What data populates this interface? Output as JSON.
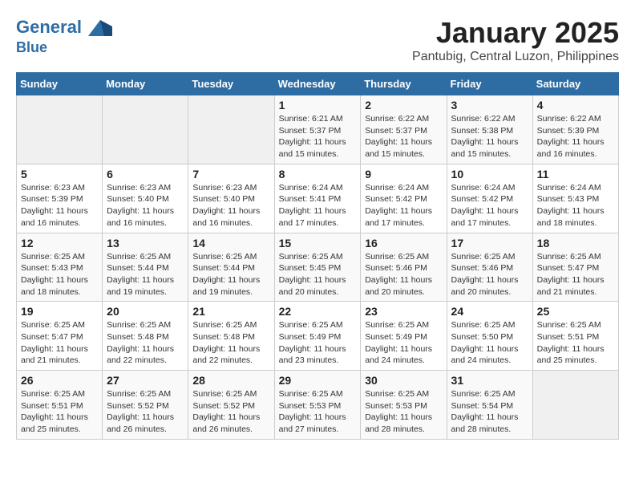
{
  "header": {
    "logo_line1": "General",
    "logo_line2": "Blue",
    "title": "January 2025",
    "subtitle": "Pantubig, Central Luzon, Philippines"
  },
  "weekdays": [
    "Sunday",
    "Monday",
    "Tuesday",
    "Wednesday",
    "Thursday",
    "Friday",
    "Saturday"
  ],
  "weeks": [
    [
      {
        "day": "",
        "info": ""
      },
      {
        "day": "",
        "info": ""
      },
      {
        "day": "",
        "info": ""
      },
      {
        "day": "1",
        "info": "Sunrise: 6:21 AM\nSunset: 5:37 PM\nDaylight: 11 hours and 15 minutes."
      },
      {
        "day": "2",
        "info": "Sunrise: 6:22 AM\nSunset: 5:37 PM\nDaylight: 11 hours and 15 minutes."
      },
      {
        "day": "3",
        "info": "Sunrise: 6:22 AM\nSunset: 5:38 PM\nDaylight: 11 hours and 15 minutes."
      },
      {
        "day": "4",
        "info": "Sunrise: 6:22 AM\nSunset: 5:39 PM\nDaylight: 11 hours and 16 minutes."
      }
    ],
    [
      {
        "day": "5",
        "info": "Sunrise: 6:23 AM\nSunset: 5:39 PM\nDaylight: 11 hours and 16 minutes."
      },
      {
        "day": "6",
        "info": "Sunrise: 6:23 AM\nSunset: 5:40 PM\nDaylight: 11 hours and 16 minutes."
      },
      {
        "day": "7",
        "info": "Sunrise: 6:23 AM\nSunset: 5:40 PM\nDaylight: 11 hours and 16 minutes."
      },
      {
        "day": "8",
        "info": "Sunrise: 6:24 AM\nSunset: 5:41 PM\nDaylight: 11 hours and 17 minutes."
      },
      {
        "day": "9",
        "info": "Sunrise: 6:24 AM\nSunset: 5:42 PM\nDaylight: 11 hours and 17 minutes."
      },
      {
        "day": "10",
        "info": "Sunrise: 6:24 AM\nSunset: 5:42 PM\nDaylight: 11 hours and 17 minutes."
      },
      {
        "day": "11",
        "info": "Sunrise: 6:24 AM\nSunset: 5:43 PM\nDaylight: 11 hours and 18 minutes."
      }
    ],
    [
      {
        "day": "12",
        "info": "Sunrise: 6:25 AM\nSunset: 5:43 PM\nDaylight: 11 hours and 18 minutes."
      },
      {
        "day": "13",
        "info": "Sunrise: 6:25 AM\nSunset: 5:44 PM\nDaylight: 11 hours and 19 minutes."
      },
      {
        "day": "14",
        "info": "Sunrise: 6:25 AM\nSunset: 5:44 PM\nDaylight: 11 hours and 19 minutes."
      },
      {
        "day": "15",
        "info": "Sunrise: 6:25 AM\nSunset: 5:45 PM\nDaylight: 11 hours and 20 minutes."
      },
      {
        "day": "16",
        "info": "Sunrise: 6:25 AM\nSunset: 5:46 PM\nDaylight: 11 hours and 20 minutes."
      },
      {
        "day": "17",
        "info": "Sunrise: 6:25 AM\nSunset: 5:46 PM\nDaylight: 11 hours and 20 minutes."
      },
      {
        "day": "18",
        "info": "Sunrise: 6:25 AM\nSunset: 5:47 PM\nDaylight: 11 hours and 21 minutes."
      }
    ],
    [
      {
        "day": "19",
        "info": "Sunrise: 6:25 AM\nSunset: 5:47 PM\nDaylight: 11 hours and 21 minutes."
      },
      {
        "day": "20",
        "info": "Sunrise: 6:25 AM\nSunset: 5:48 PM\nDaylight: 11 hours and 22 minutes."
      },
      {
        "day": "21",
        "info": "Sunrise: 6:25 AM\nSunset: 5:48 PM\nDaylight: 11 hours and 22 minutes."
      },
      {
        "day": "22",
        "info": "Sunrise: 6:25 AM\nSunset: 5:49 PM\nDaylight: 11 hours and 23 minutes."
      },
      {
        "day": "23",
        "info": "Sunrise: 6:25 AM\nSunset: 5:49 PM\nDaylight: 11 hours and 24 minutes."
      },
      {
        "day": "24",
        "info": "Sunrise: 6:25 AM\nSunset: 5:50 PM\nDaylight: 11 hours and 24 minutes."
      },
      {
        "day": "25",
        "info": "Sunrise: 6:25 AM\nSunset: 5:51 PM\nDaylight: 11 hours and 25 minutes."
      }
    ],
    [
      {
        "day": "26",
        "info": "Sunrise: 6:25 AM\nSunset: 5:51 PM\nDaylight: 11 hours and 25 minutes."
      },
      {
        "day": "27",
        "info": "Sunrise: 6:25 AM\nSunset: 5:52 PM\nDaylight: 11 hours and 26 minutes."
      },
      {
        "day": "28",
        "info": "Sunrise: 6:25 AM\nSunset: 5:52 PM\nDaylight: 11 hours and 26 minutes."
      },
      {
        "day": "29",
        "info": "Sunrise: 6:25 AM\nSunset: 5:53 PM\nDaylight: 11 hours and 27 minutes."
      },
      {
        "day": "30",
        "info": "Sunrise: 6:25 AM\nSunset: 5:53 PM\nDaylight: 11 hours and 28 minutes."
      },
      {
        "day": "31",
        "info": "Sunrise: 6:25 AM\nSunset: 5:54 PM\nDaylight: 11 hours and 28 minutes."
      },
      {
        "day": "",
        "info": ""
      }
    ]
  ]
}
